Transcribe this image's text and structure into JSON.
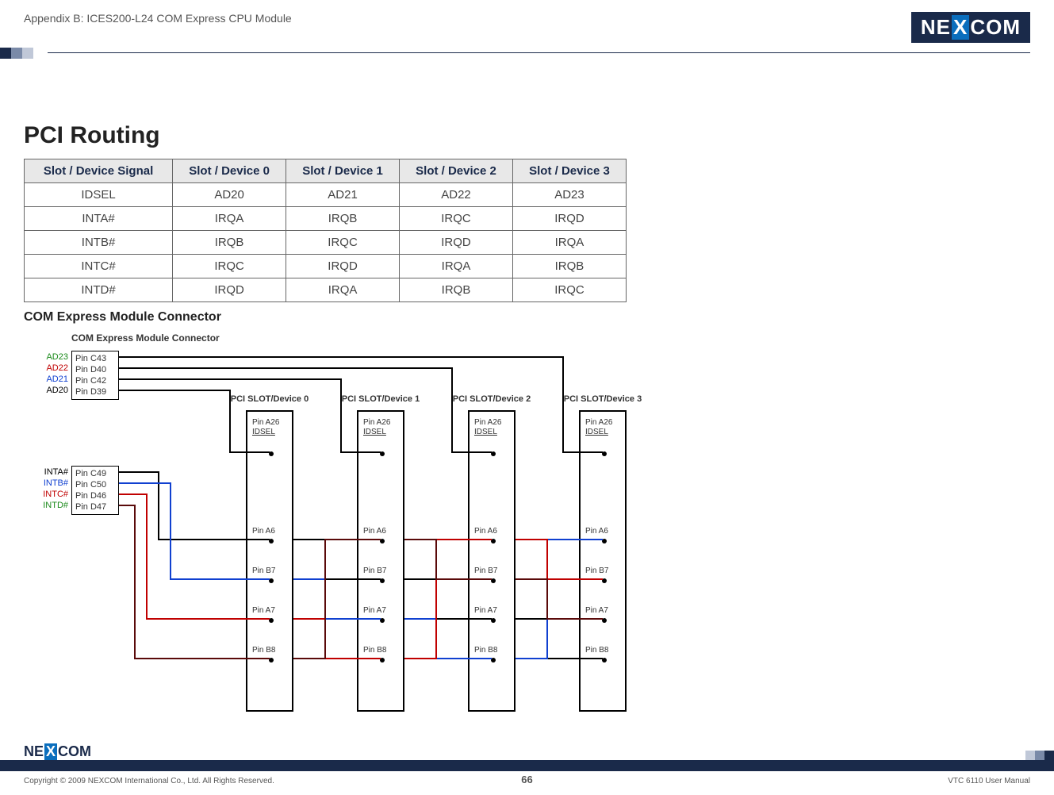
{
  "header": {
    "appendix_title": "Appendix B: ICES200-L24 COM Express CPU Module",
    "brand_prefix": "NE",
    "brand_mid": "X",
    "brand_suffix": "COM"
  },
  "main": {
    "heading": "PCI Routing",
    "table_headers": [
      "Slot / Device Signal",
      "Slot / Device 0",
      "Slot / Device 1",
      "Slot / Device 2",
      "Slot / Device 3"
    ],
    "table_rows": [
      {
        "cells": [
          "IDSEL",
          "AD20",
          "AD21",
          "AD22",
          "AD23"
        ]
      },
      {
        "cells": [
          "INTA#",
          "IRQA",
          "IRQB",
          "IRQC",
          "IRQD"
        ]
      },
      {
        "cells": [
          "INTB#",
          "IRQB",
          "IRQC",
          "IRQD",
          "IRQA"
        ]
      },
      {
        "cells": [
          "INTC#",
          "IRQC",
          "IRQD",
          "IRQA",
          "IRQB"
        ]
      },
      {
        "cells": [
          "INTD#",
          "IRQD",
          "IRQA",
          "IRQB",
          "IRQC"
        ]
      }
    ],
    "subheading": "COM Express Module Connector"
  },
  "diagram": {
    "title": "COM Express Module Connector",
    "ad_labels": [
      {
        "text": "AD23",
        "color": "#1a8a1a"
      },
      {
        "text": "AD22",
        "color": "#c00000"
      },
      {
        "text": "AD21",
        "color": "#1040d0"
      },
      {
        "text": "AD20",
        "color": "#000000"
      }
    ],
    "ad_pins": [
      "Pin C43",
      "Pin D40",
      "Pin C42",
      "Pin D39"
    ],
    "int_labels": [
      {
        "text": "INTA#",
        "color": "#000000"
      },
      {
        "text": "INTB#",
        "color": "#1040d0"
      },
      {
        "text": "INTC#",
        "color": "#c00000"
      },
      {
        "text": "INTD#",
        "color": "#1a8a1a"
      }
    ],
    "int_pins": [
      "Pin C49",
      "Pin C50",
      "Pin D46",
      "Pin D47"
    ],
    "slots": [
      {
        "title": "PCI SLOT/Device 0"
      },
      {
        "title": "PCI SLOT/Device 1"
      },
      {
        "title": "PCI SLOT/Device 2"
      },
      {
        "title": "PCI SLOT/Device 3"
      }
    ],
    "slot_pins_top": [
      "Pin A26",
      "IDSEL"
    ],
    "slot_pins_rows": [
      "Pin A6",
      "Pin B7",
      "Pin A7",
      "Pin B8"
    ]
  },
  "footer": {
    "brand_prefix": "NE",
    "brand_mid": "X",
    "brand_suffix": "COM",
    "copyright": "Copyright © 2009 NEXCOM International Co., Ltd. All Rights Reserved.",
    "page": "66",
    "manual": "VTC 6110 User Manual"
  }
}
